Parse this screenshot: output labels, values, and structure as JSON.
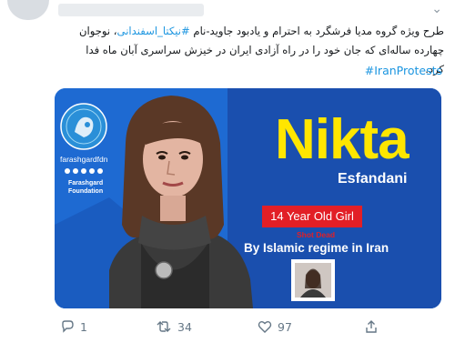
{
  "tweet": {
    "text_line1_prefix": "طرح ویژه گروه مدیا فرشگرد به احترام و یادبود جاوید-نام",
    "hashtag_name": "#نیکتا_اسفندانی",
    "text_line1_suffix": "، نوجوان چهارده",
    "text_line2": "ساله‌ای که جان خود را در راه آزادی ایران در خیزش سراسری آبان ماه فدا کرد.",
    "hashtag_tag": "#IranProtests"
  },
  "card": {
    "first_name": "Nikta",
    "last_name": "Esfandani",
    "age_label": "14 Year Old Girl",
    "shot_label": "Shot Dead",
    "regime_label": "By Islamic regime in Iran",
    "logo": {
      "handle": "farashgardfdn",
      "org_line1": "Farashgard",
      "org_line2": "Foundation"
    }
  },
  "actions": {
    "reply_count": "1",
    "retweet_count": "34",
    "like_count": "97"
  },
  "colors": {
    "card_blue": "#1e6ad2",
    "name_yellow": "#ffe600",
    "age_red": "#e21f26",
    "hashtag_blue": "#1b95e0",
    "icon_gray": "#657786"
  },
  "icons": [
    "chevron-down-icon",
    "reply-icon",
    "retweet-icon",
    "like-icon",
    "share-icon",
    "lion-sun-logo-icon",
    "social-icons"
  ]
}
